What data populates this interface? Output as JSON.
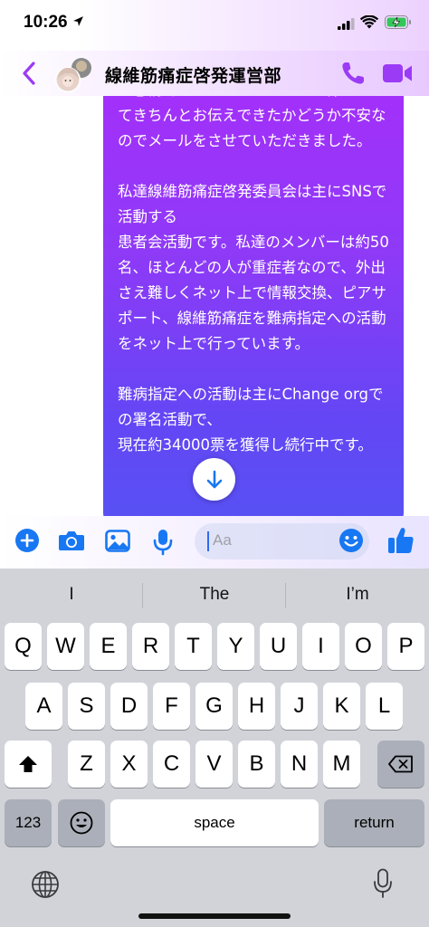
{
  "status": {
    "time": "10:26"
  },
  "header": {
    "title": "線維筋痛症啓発運営部"
  },
  "message": {
    "text": "し感情的になってしまい、この件について​きちんとお伝えできたかどうか不安なのでメールをさせていただきました。\n\n私達線維筋痛症啓発委員会は主にSNSで活動する\n患者会活動です。私達のメンバーは約50名、ほとんどの人が重症者なので、外出さえ難しくネット上で情報交換、ピアサポート、線維筋痛症を難病指定への活動をネット上で行っています。\n\n難病指定への活動は主にChange orgでの署名活動で、\n現在約34000票を獲得し続行中です。"
  },
  "composer": {
    "placeholder": "Aa"
  },
  "keyboard": {
    "suggestions": [
      "I",
      "The",
      "I’m"
    ],
    "row1": [
      "Q",
      "W",
      "E",
      "R",
      "T",
      "Y",
      "U",
      "I",
      "O",
      "P"
    ],
    "row2": [
      "A",
      "S",
      "D",
      "F",
      "G",
      "H",
      "J",
      "K",
      "L"
    ],
    "row3": [
      "Z",
      "X",
      "C",
      "V",
      "B",
      "N",
      "M"
    ],
    "numbers_label": "123",
    "space_label": "space",
    "return_label": "return"
  },
  "colors": {
    "accent": "#9b3bf5",
    "blue": "#1877f2",
    "bubble_top": "#a52ffa",
    "bubble_bottom": "#5652f3"
  }
}
